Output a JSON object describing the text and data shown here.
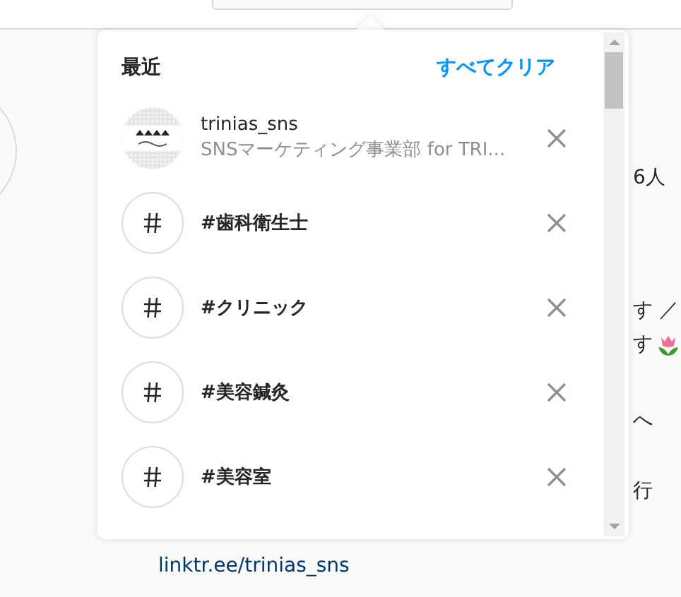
{
  "page": {
    "side_texts": [
      "6人",
      "す ／",
      "す",
      "へ",
      "行"
    ],
    "link": "linktr.ee/trinias_sns"
  },
  "popup": {
    "title": "最近",
    "clear_all": "すべてクリア",
    "items": [
      {
        "kind": "account",
        "name": "trinias_sns",
        "subtitle": "SNSマーケティング事業部 for TRI..."
      },
      {
        "kind": "hashtag",
        "name": "#歯科衛生士"
      },
      {
        "kind": "hashtag",
        "name": "#クリニック"
      },
      {
        "kind": "hashtag",
        "name": "#美容鍼灸"
      },
      {
        "kind": "hashtag",
        "name": "#美容室"
      }
    ]
  }
}
